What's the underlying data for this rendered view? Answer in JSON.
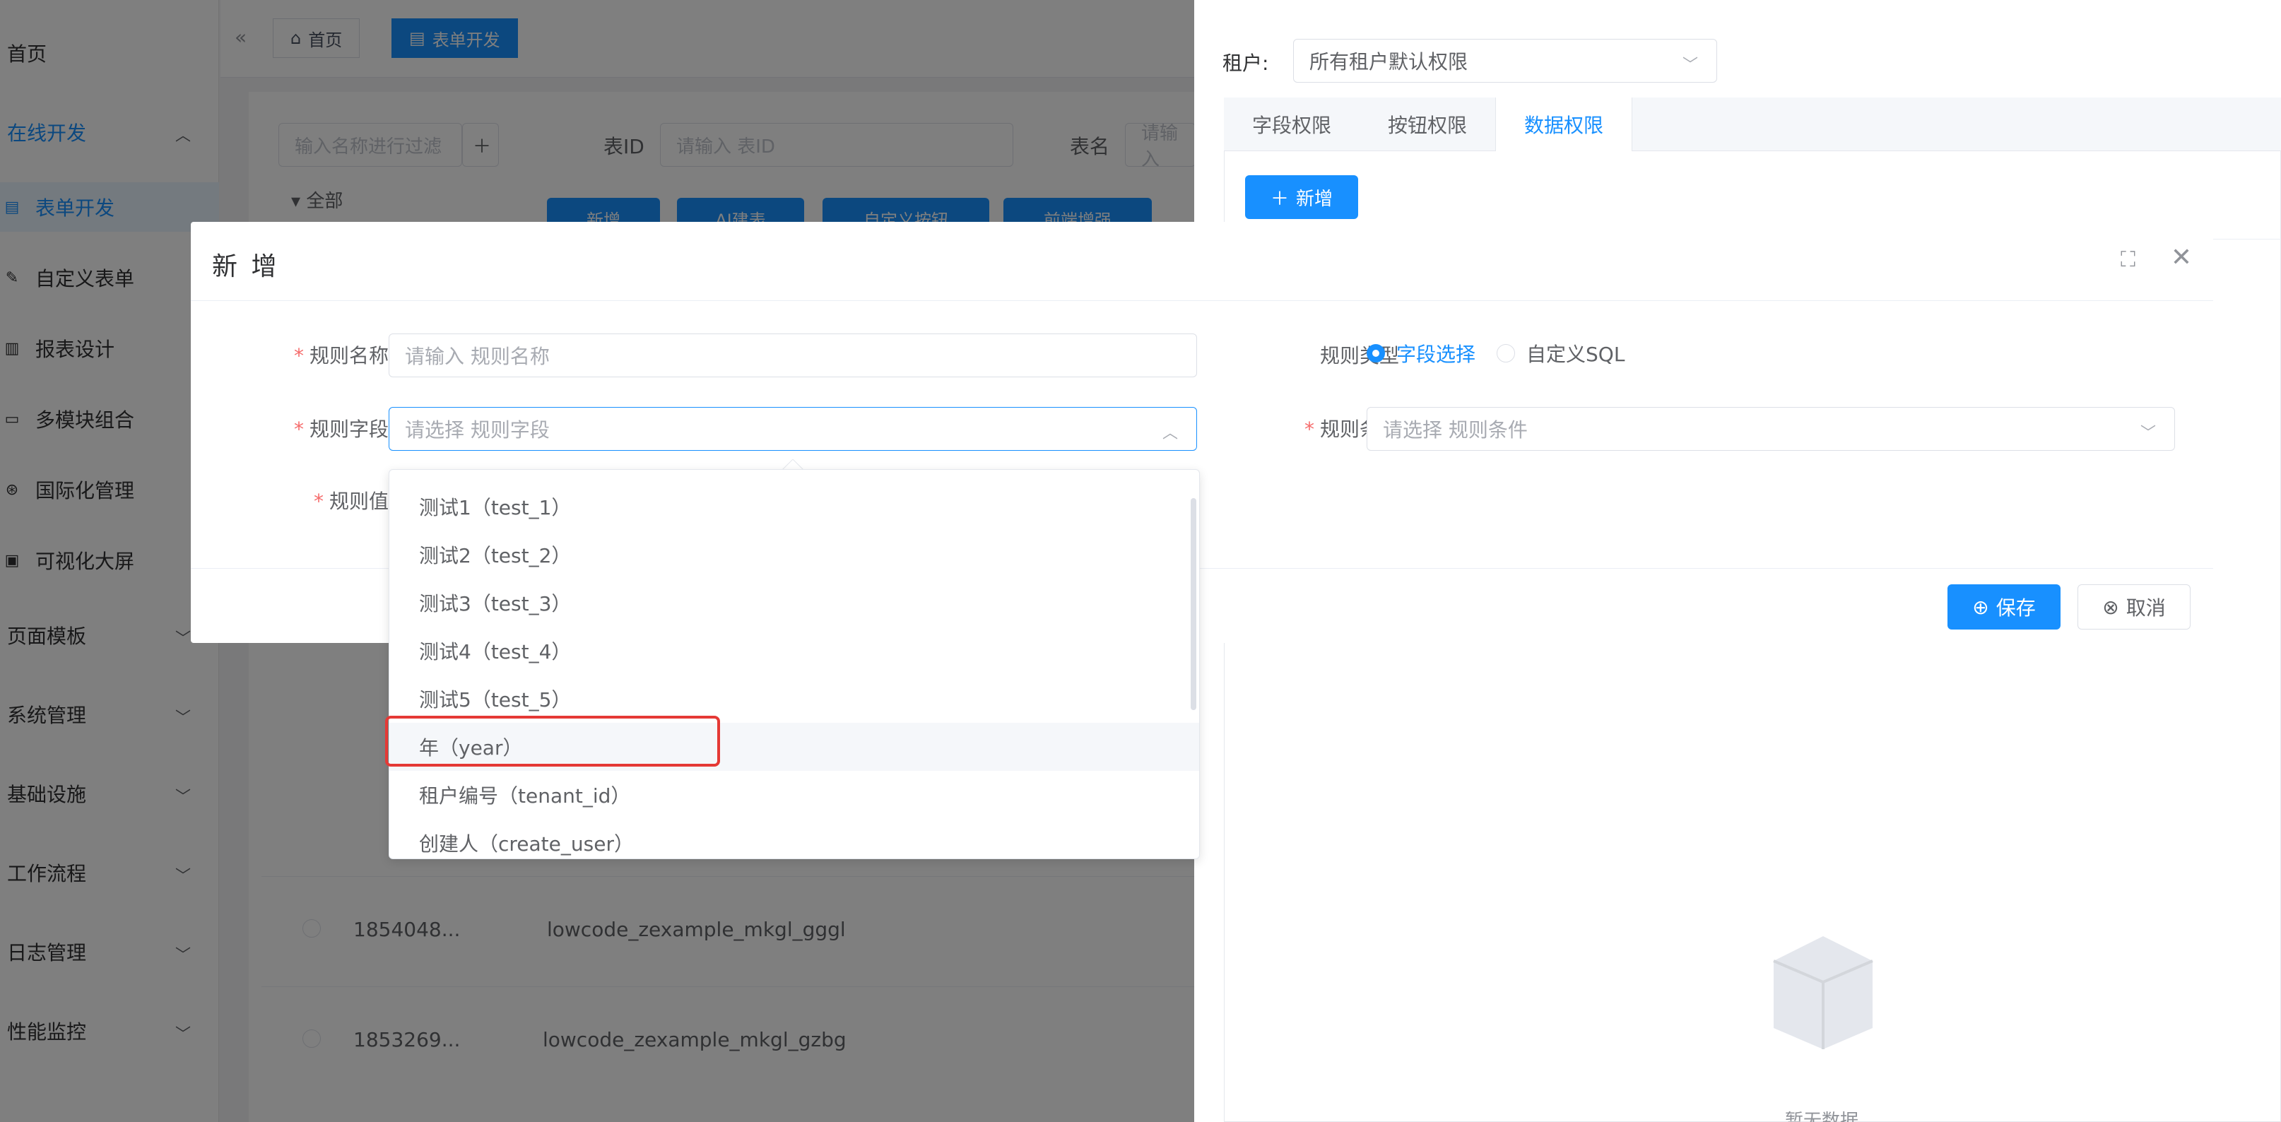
{
  "sidebar": {
    "items": [
      {
        "label": "首页"
      },
      {
        "label": "在线开发"
      },
      {
        "label": "表单开发"
      },
      {
        "label": "自定义表单"
      },
      {
        "label": "报表设计"
      },
      {
        "label": "多模块组合"
      },
      {
        "label": "国际化管理"
      },
      {
        "label": "可视化大屏"
      },
      {
        "label": "页面模板"
      },
      {
        "label": "系统管理"
      },
      {
        "label": "基础设施"
      },
      {
        "label": "工作流程"
      },
      {
        "label": "日志管理"
      },
      {
        "label": "性能监控"
      }
    ]
  },
  "tabs": {
    "home": "首页",
    "form_dev": "表单开发"
  },
  "content": {
    "filter_placeholder": "输入名称进行过滤",
    "tree_all": "全部",
    "table_id_label": "表ID",
    "table_id_placeholder": "请输入 表ID",
    "table_name_label": "表名",
    "table_name_placeholder": "请输入",
    "toolbar": [
      "新增",
      "AI建表",
      "自定义按钮",
      "前端增强"
    ],
    "rows": [
      {
        "id": "1854048...",
        "name": "lowcode_zexample_mkgl_gggl"
      },
      {
        "id": "1853269...",
        "name": "lowcode_zexample_mkgl_gzbg"
      }
    ]
  },
  "drawer": {
    "tenant_label": "租户:",
    "tenant_value": "所有租户默认权限",
    "tabs": [
      "字段权限",
      "按钮权限",
      "数据权限"
    ],
    "add_button": "新增",
    "empty_text": "暂无数据"
  },
  "modal": {
    "title": "新 增",
    "rule_name_label": "规则名称",
    "rule_name_placeholder": "请输入 规则名称",
    "rule_field_label": "规则字段",
    "rule_field_placeholder": "请选择 规则字段",
    "rule_value_label": "规则值",
    "rule_type_label": "规则类型",
    "rule_type_options": [
      "字段选择",
      "自定义SQL"
    ],
    "rule_condition_label": "规则条件",
    "rule_condition_placeholder": "请选择 规则条件",
    "save": "保存",
    "cancel": "取消"
  },
  "dropdown": {
    "options": [
      "测试1（test_1）",
      "测试2（test_2）",
      "测试3（test_3）",
      "测试4（test_4）",
      "测试5（test_5）",
      "年（year）",
      "租户编号（tenant_id）",
      "创建人（create_user）"
    ]
  }
}
